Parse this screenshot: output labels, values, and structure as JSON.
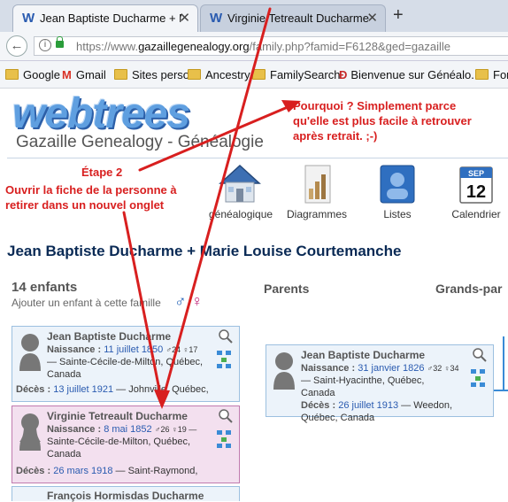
{
  "browser": {
    "tabs": [
      {
        "icon": "W",
        "title": "Jean Baptiste Ducharme + Marie Louise Courtemanche",
        "close": "✕"
      },
      {
        "icon": "W",
        "title": "Virginie Tetreault Ducharme",
        "close": "✕"
      }
    ],
    "new_tab": "+",
    "url_prefix": "https://www.",
    "url_domain": "gazaillegenealogy.org",
    "url_path": "/family.php?famid=F6128&ged=gazaille",
    "bookmarks": [
      "Google",
      "Gmail",
      "Sites perso",
      "Ancestry",
      "FamilySearch",
      "Bienvenue sur Généalo...",
      "For"
    ]
  },
  "site": {
    "logo": "webtrees",
    "title": "Gazaille Genealogy - Généalogie",
    "menu": [
      {
        "label": "généalogique",
        "icon": "home-icon"
      },
      {
        "label": "Diagrammes",
        "icon": "chart-icon"
      },
      {
        "label": "Listes",
        "icon": "list-icon"
      },
      {
        "label": "Calendrier",
        "icon": "calendar-icon",
        "cal_month": "SEP",
        "cal_day": "12"
      }
    ]
  },
  "family": {
    "heading": "Jean Baptiste Ducharme + Marie Louise Courtemanche",
    "children_count": "14 enfants",
    "add_child": "Ajouter un enfant à cette famille",
    "male_symbol": "♂",
    "female_symbol": "♀",
    "parents_heading": "Parents",
    "grandparents_heading": "Grands-par",
    "children": [
      {
        "name": "Jean Baptiste Ducharme",
        "birth_label": "Naissance :",
        "birth_date": "11 juillet 1850",
        "ages": "♂24 ♀17",
        "birth_place": "— Sainte-Cécile-de-Milton, Québec, Canada",
        "death_label": "Décès :",
        "death_date": "13 juillet 1921",
        "death_place": "— Johnville, Québec,"
      },
      {
        "name": "Virginie Tetreault Ducharme",
        "birth_label": "Naissance :",
        "birth_date": "8 mai 1852",
        "ages": "♂26 ♀19 —",
        "birth_place": "Sainte-Cécile-de-Milton, Québec, Canada",
        "death_label": "Décès :",
        "death_date": "26 mars 1918",
        "death_place": "— Saint-Raymond,"
      },
      {
        "name": "François Hormisdas Ducharme"
      }
    ],
    "parent": {
      "name": "Jean Baptiste Ducharme",
      "birth_label": "Naissance :",
      "birth_date": "31 janvier 1826",
      "ages": "♂32 ♀34",
      "birth_place": "— Saint-Hyacinthe, Québec, Canada",
      "death_label": "Décès :",
      "death_date": "26 juillet 1913",
      "death_place": "— Weedon, Québec, Canada"
    }
  },
  "annotations": {
    "step_title": "Étape 2",
    "step_text_1": "Ouvrir la fiche de la personne à",
    "step_text_2": "retirer dans un nouvel onglet",
    "why_1": "Pourquoi ? Simplement parce",
    "why_2": "qu'elle est plus facile à retrouver",
    "why_3": "après retrait. ;-)",
    "color": "#d81f1f"
  }
}
